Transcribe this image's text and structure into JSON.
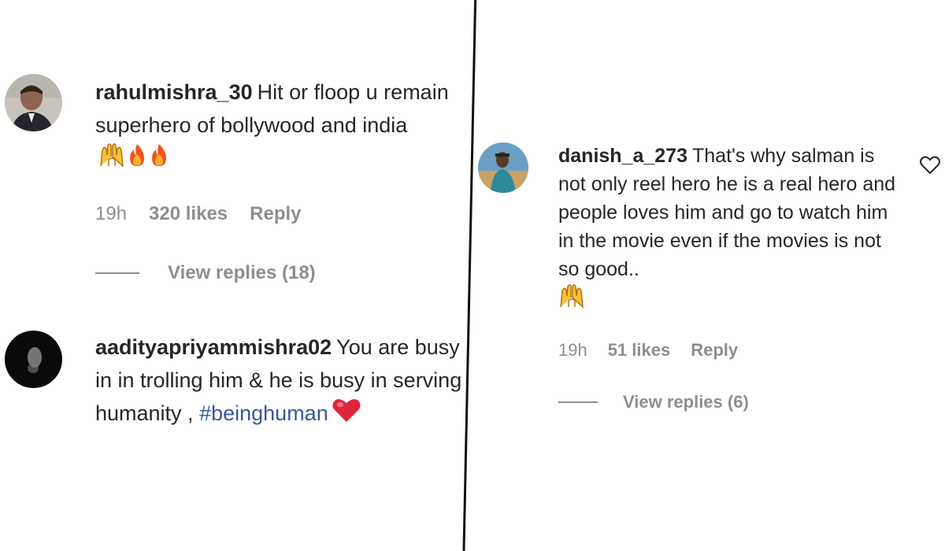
{
  "comments": [
    {
      "username": "rahulmishra_30",
      "text": "Hit or floop u remain superhero of bollywood and india",
      "time": "19h",
      "likes": "320 likes",
      "reply": "Reply",
      "view_replies": "View replies (18)",
      "emojis": [
        "raising-hands",
        "fire",
        "fire"
      ]
    },
    {
      "username": "aadityapriyammishra02",
      "text": "You are busy in in trolling him & he is busy in serving humanity ,",
      "hashtag": "#beinghuman",
      "emojis": [
        "red-heart"
      ]
    },
    {
      "username": "danish_a_273",
      "text": "That's why salman is not only reel hero he is a real hero and people loves him and go to watch him in the movie even if the movies is not so good..",
      "time": "19h",
      "likes": "51 likes",
      "reply": "Reply",
      "view_replies": "View replies (6)",
      "emojis": [
        "raising-hands"
      ]
    }
  ],
  "icons": {
    "like": "heart-outline-icon",
    "avatars": [
      "avatar-rahulmishra",
      "avatar-aadityapriyammishra",
      "avatar-danish"
    ]
  },
  "colors": {
    "text": "#262626",
    "muted": "#8e8e8e",
    "hashtag": "#385898",
    "divider": "#111111"
  }
}
